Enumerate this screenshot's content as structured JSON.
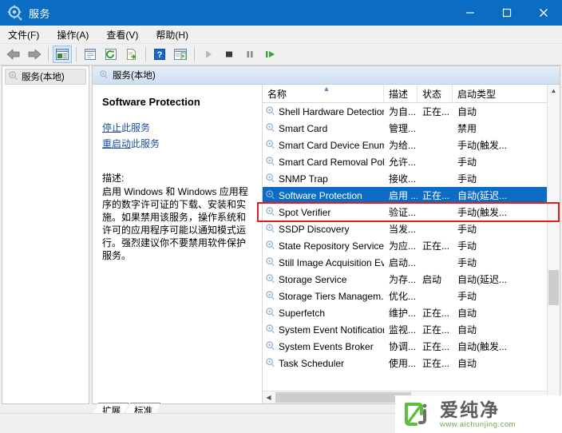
{
  "window": {
    "title": "服务",
    "icon": "services-gear-icon",
    "accent": "#0b6cc4",
    "controls": {
      "minimize": "minimize-icon",
      "maximize": "maximize-icon",
      "close": "close-icon"
    }
  },
  "menubar": {
    "items": [
      {
        "label": "文件(F)",
        "name": "menu-file"
      },
      {
        "label": "操作(A)",
        "name": "menu-action"
      },
      {
        "label": "查看(V)",
        "name": "menu-view"
      },
      {
        "label": "帮助(H)",
        "name": "menu-help"
      }
    ]
  },
  "toolbar": {
    "items": [
      {
        "name": "back-icon",
        "kind": "arrow-left"
      },
      {
        "name": "forward-icon",
        "kind": "arrow-right"
      },
      {
        "name": "show-hide-tree-icon",
        "kind": "tree",
        "selected": true
      },
      {
        "name": "properties-icon",
        "kind": "props"
      },
      {
        "name": "refresh-icon",
        "kind": "refresh"
      },
      {
        "name": "export-list-icon",
        "kind": "export"
      },
      {
        "name": "help-icon",
        "kind": "help"
      },
      {
        "name": "show-action-pane-icon",
        "kind": "pane"
      },
      {
        "name": "start-service-icon",
        "kind": "play"
      },
      {
        "name": "stop-service-icon",
        "kind": "stop"
      },
      {
        "name": "pause-service-icon",
        "kind": "pause"
      },
      {
        "name": "restart-service-icon",
        "kind": "restart"
      }
    ]
  },
  "tree": {
    "root": "服务(本地)"
  },
  "pane": {
    "header": "服务(本地)"
  },
  "details": {
    "service_name": "Software Protection",
    "stop_link_underline": "停止",
    "stop_link_rest": "此服务",
    "restart_link_underline": "重启动",
    "restart_link_rest": "此服务",
    "description_label": "描述:",
    "description": "启用 Windows 和 Windows 应用程序的数字许可证的下载、安装和实施。如果禁用该服务，操作系统和许可的应用程序可能以通知模式运行。强烈建议你不要禁用软件保护服务。"
  },
  "list": {
    "columns": [
      {
        "label": "名称",
        "key": "name",
        "sorted": "asc"
      },
      {
        "label": "描述",
        "key": "desc"
      },
      {
        "label": "状态",
        "key": "state"
      },
      {
        "label": "启动类型",
        "key": "start"
      }
    ],
    "rows": [
      {
        "name": "Shell Hardware Detection",
        "desc": "为自...",
        "state": "正在...",
        "start": "自动",
        "selected": false
      },
      {
        "name": "Smart Card",
        "desc": "管理...",
        "state": "",
        "start": "禁用",
        "selected": false
      },
      {
        "name": "Smart Card Device Enum...",
        "desc": "为给...",
        "state": "",
        "start": "手动(触发...",
        "selected": false
      },
      {
        "name": "Smart Card Removal Poli...",
        "desc": "允许...",
        "state": "",
        "start": "手动",
        "selected": false
      },
      {
        "name": "SNMP Trap",
        "desc": "接收...",
        "state": "",
        "start": "手动",
        "selected": false
      },
      {
        "name": "Software Protection",
        "desc": "启用 ...",
        "state": "正在...",
        "start": "自动(延迟...",
        "selected": true
      },
      {
        "name": "Spot Verifier",
        "desc": "验证...",
        "state": "",
        "start": "手动(触发...",
        "selected": false
      },
      {
        "name": "SSDP Discovery",
        "desc": "当发...",
        "state": "",
        "start": "手动",
        "selected": false
      },
      {
        "name": "State Repository Service",
        "desc": "为应...",
        "state": "正在...",
        "start": "手动",
        "selected": false
      },
      {
        "name": "Still Image Acquisition Ev...",
        "desc": "启动...",
        "state": "",
        "start": "手动",
        "selected": false
      },
      {
        "name": "Storage Service",
        "desc": "为存...",
        "state": "启动",
        "start": "自动(延迟...",
        "selected": false
      },
      {
        "name": "Storage Tiers Managem...",
        "desc": "优化...",
        "state": "",
        "start": "手动",
        "selected": false
      },
      {
        "name": "Superfetch",
        "desc": "维护...",
        "state": "正在...",
        "start": "自动",
        "selected": false
      },
      {
        "name": "System Event Notification...",
        "desc": "监视...",
        "state": "正在...",
        "start": "自动",
        "selected": false
      },
      {
        "name": "System Events Broker",
        "desc": "协调...",
        "state": "正在...",
        "start": "自动(触发...",
        "selected": false
      },
      {
        "name": "Task Scheduler",
        "desc": "使用...",
        "state": "正在...",
        "start": "自动",
        "selected": false
      }
    ],
    "highlight_color": "#e02020"
  },
  "tabs": [
    {
      "label": "扩展",
      "name": "tab-extended"
    },
    {
      "label": "标准",
      "name": "tab-standard"
    }
  ],
  "watermark": {
    "brand": "爱纯净",
    "url": "www.aichunjing.com",
    "color": "#5cc03c"
  }
}
